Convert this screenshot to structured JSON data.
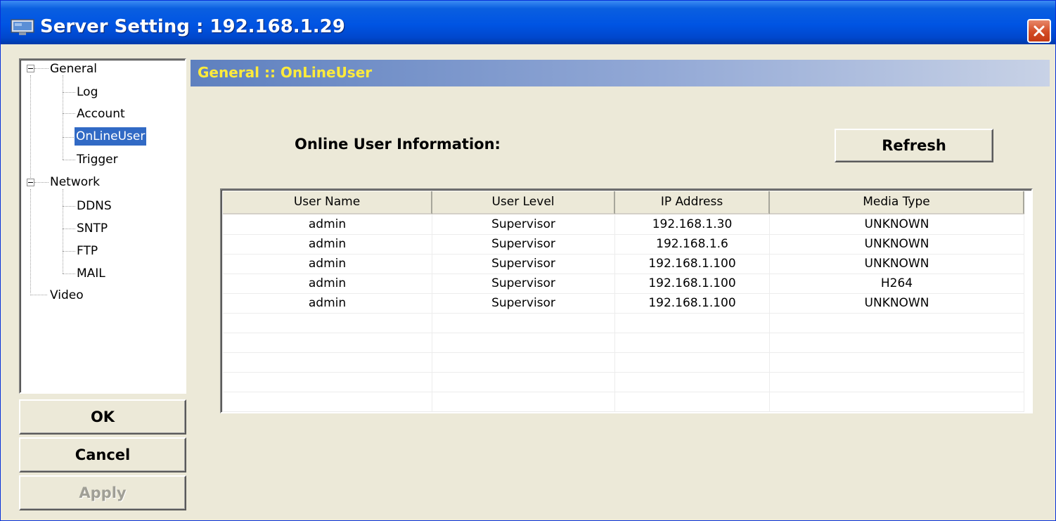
{
  "window": {
    "title": "Server Setting : 192.168.1.29",
    "title_bar_color": "#0054e3"
  },
  "tree": {
    "items": [
      {
        "label": "General",
        "expandable": true,
        "expanded": true
      },
      {
        "label": "Log"
      },
      {
        "label": "Account"
      },
      {
        "label": "OnLineUser",
        "selected": true
      },
      {
        "label": "Trigger"
      },
      {
        "label": "Network",
        "expandable": true,
        "expanded": true
      },
      {
        "label": "DDNS"
      },
      {
        "label": "SNTP"
      },
      {
        "label": "FTP"
      },
      {
        "label": "MAIL"
      },
      {
        "label": "Video"
      }
    ]
  },
  "buttons": {
    "ok": "OK",
    "cancel": "Cancel",
    "apply": "Apply",
    "refresh": "Refresh"
  },
  "section": {
    "title": "General :: OnLineUser",
    "title_color": "#ffeb3b"
  },
  "online_users": {
    "label": "Online User Information:",
    "columns": [
      "User Name",
      "User Level",
      "IP Address",
      "Media Type"
    ],
    "rows": [
      [
        "admin",
        "Supervisor",
        "192.168.1.30",
        "UNKNOWN"
      ],
      [
        "admin",
        "Supervisor",
        "192.168.1.6",
        "UNKNOWN"
      ],
      [
        "admin",
        "Supervisor",
        "192.168.1.100",
        "UNKNOWN"
      ],
      [
        "admin",
        "Supervisor",
        "192.168.1.100",
        "H264"
      ],
      [
        "admin",
        "Supervisor",
        "192.168.1.100",
        "UNKNOWN"
      ],
      [
        "",
        "",
        "",
        ""
      ],
      [
        "",
        "",
        "",
        ""
      ],
      [
        "",
        "",
        "",
        ""
      ],
      [
        "",
        "",
        "",
        ""
      ],
      [
        "",
        "",
        "",
        ""
      ]
    ]
  },
  "colors": {
    "selection": "#316ac5",
    "dialog_background": "#ece9d8"
  }
}
